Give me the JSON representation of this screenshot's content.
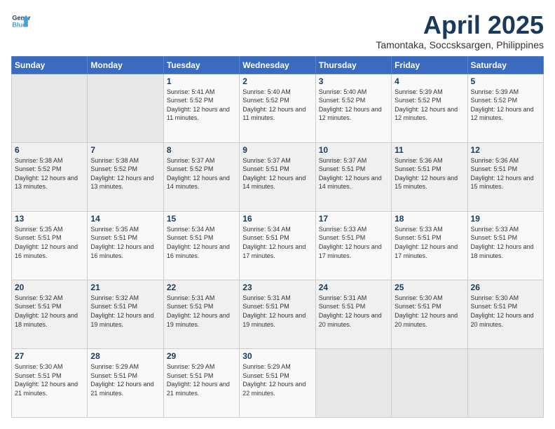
{
  "header": {
    "logo_line1": "General",
    "logo_line2": "Blue",
    "title": "April 2025",
    "subtitle": "Tamontaka, Soccsksargen, Philippines"
  },
  "weekdays": [
    "Sunday",
    "Monday",
    "Tuesday",
    "Wednesday",
    "Thursday",
    "Friday",
    "Saturday"
  ],
  "weeks": [
    [
      {
        "day": "",
        "info": ""
      },
      {
        "day": "",
        "info": ""
      },
      {
        "day": "1",
        "info": "Sunrise: 5:41 AM\nSunset: 5:52 PM\nDaylight: 12 hours and 11 minutes."
      },
      {
        "day": "2",
        "info": "Sunrise: 5:40 AM\nSunset: 5:52 PM\nDaylight: 12 hours and 11 minutes."
      },
      {
        "day": "3",
        "info": "Sunrise: 5:40 AM\nSunset: 5:52 PM\nDaylight: 12 hours and 12 minutes."
      },
      {
        "day": "4",
        "info": "Sunrise: 5:39 AM\nSunset: 5:52 PM\nDaylight: 12 hours and 12 minutes."
      },
      {
        "day": "5",
        "info": "Sunrise: 5:39 AM\nSunset: 5:52 PM\nDaylight: 12 hours and 12 minutes."
      }
    ],
    [
      {
        "day": "6",
        "info": "Sunrise: 5:38 AM\nSunset: 5:52 PM\nDaylight: 12 hours and 13 minutes."
      },
      {
        "day": "7",
        "info": "Sunrise: 5:38 AM\nSunset: 5:52 PM\nDaylight: 12 hours and 13 minutes."
      },
      {
        "day": "8",
        "info": "Sunrise: 5:37 AM\nSunset: 5:52 PM\nDaylight: 12 hours and 14 minutes."
      },
      {
        "day": "9",
        "info": "Sunrise: 5:37 AM\nSunset: 5:51 PM\nDaylight: 12 hours and 14 minutes."
      },
      {
        "day": "10",
        "info": "Sunrise: 5:37 AM\nSunset: 5:51 PM\nDaylight: 12 hours and 14 minutes."
      },
      {
        "day": "11",
        "info": "Sunrise: 5:36 AM\nSunset: 5:51 PM\nDaylight: 12 hours and 15 minutes."
      },
      {
        "day": "12",
        "info": "Sunrise: 5:36 AM\nSunset: 5:51 PM\nDaylight: 12 hours and 15 minutes."
      }
    ],
    [
      {
        "day": "13",
        "info": "Sunrise: 5:35 AM\nSunset: 5:51 PM\nDaylight: 12 hours and 16 minutes."
      },
      {
        "day": "14",
        "info": "Sunrise: 5:35 AM\nSunset: 5:51 PM\nDaylight: 12 hours and 16 minutes."
      },
      {
        "day": "15",
        "info": "Sunrise: 5:34 AM\nSunset: 5:51 PM\nDaylight: 12 hours and 16 minutes."
      },
      {
        "day": "16",
        "info": "Sunrise: 5:34 AM\nSunset: 5:51 PM\nDaylight: 12 hours and 17 minutes."
      },
      {
        "day": "17",
        "info": "Sunrise: 5:33 AM\nSunset: 5:51 PM\nDaylight: 12 hours and 17 minutes."
      },
      {
        "day": "18",
        "info": "Sunrise: 5:33 AM\nSunset: 5:51 PM\nDaylight: 12 hours and 17 minutes."
      },
      {
        "day": "19",
        "info": "Sunrise: 5:33 AM\nSunset: 5:51 PM\nDaylight: 12 hours and 18 minutes."
      }
    ],
    [
      {
        "day": "20",
        "info": "Sunrise: 5:32 AM\nSunset: 5:51 PM\nDaylight: 12 hours and 18 minutes."
      },
      {
        "day": "21",
        "info": "Sunrise: 5:32 AM\nSunset: 5:51 PM\nDaylight: 12 hours and 19 minutes."
      },
      {
        "day": "22",
        "info": "Sunrise: 5:31 AM\nSunset: 5:51 PM\nDaylight: 12 hours and 19 minutes."
      },
      {
        "day": "23",
        "info": "Sunrise: 5:31 AM\nSunset: 5:51 PM\nDaylight: 12 hours and 19 minutes."
      },
      {
        "day": "24",
        "info": "Sunrise: 5:31 AM\nSunset: 5:51 PM\nDaylight: 12 hours and 20 minutes."
      },
      {
        "day": "25",
        "info": "Sunrise: 5:30 AM\nSunset: 5:51 PM\nDaylight: 12 hours and 20 minutes."
      },
      {
        "day": "26",
        "info": "Sunrise: 5:30 AM\nSunset: 5:51 PM\nDaylight: 12 hours and 20 minutes."
      }
    ],
    [
      {
        "day": "27",
        "info": "Sunrise: 5:30 AM\nSunset: 5:51 PM\nDaylight: 12 hours and 21 minutes."
      },
      {
        "day": "28",
        "info": "Sunrise: 5:29 AM\nSunset: 5:51 PM\nDaylight: 12 hours and 21 minutes."
      },
      {
        "day": "29",
        "info": "Sunrise: 5:29 AM\nSunset: 5:51 PM\nDaylight: 12 hours and 21 minutes."
      },
      {
        "day": "30",
        "info": "Sunrise: 5:29 AM\nSunset: 5:51 PM\nDaylight: 12 hours and 22 minutes."
      },
      {
        "day": "",
        "info": ""
      },
      {
        "day": "",
        "info": ""
      },
      {
        "day": "",
        "info": ""
      }
    ]
  ]
}
